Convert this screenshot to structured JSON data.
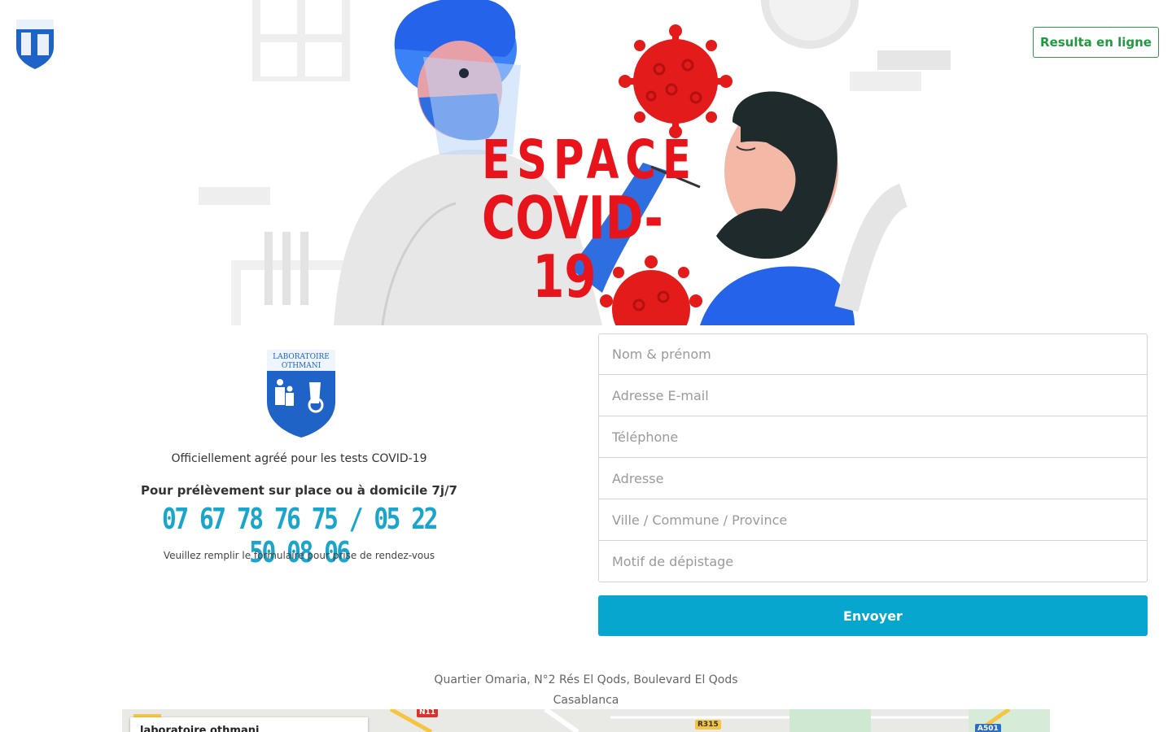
{
  "header": {
    "results_button": "Resulta en ligne"
  },
  "hero": {
    "title_line1": "ESPACE",
    "title_line2": "COVID-19"
  },
  "logo": {
    "line1": "LABORATOIRE",
    "line2": "OTHMANI"
  },
  "info": {
    "approved": "Officiellement agréé pour les tests COVID-19",
    "pickup": "Pour prélèvement sur place ou à domicile 7j/7",
    "phones": "07 67 78 76 75 / 05 22 50 08 06",
    "fill_note": "Veuillez remplir le formulaire pour prise de rendez-vous"
  },
  "form": {
    "name_placeholder": "Nom & prénom",
    "email_placeholder": "Adresse E-mail",
    "phone_placeholder": "Téléphone",
    "address_placeholder": "Adresse",
    "city_placeholder": "Ville / Commune / Province",
    "reason_placeholder": "Motif de dépistage",
    "submit_label": "Envoyer"
  },
  "address": {
    "line1": "Quartier Omaria, N°2 Rés El Qods, Boulevard El Qods",
    "line2": "Casablanca"
  },
  "map": {
    "place_name": "laboratoire othmani",
    "road_labels": [
      "N11",
      "R315",
      "A501"
    ]
  },
  "colors": {
    "accent_blue": "#06a6cf",
    "phone_blue": "#1aa5cc",
    "results_green": "#1f9a40",
    "covid_red": "#e8141c"
  }
}
